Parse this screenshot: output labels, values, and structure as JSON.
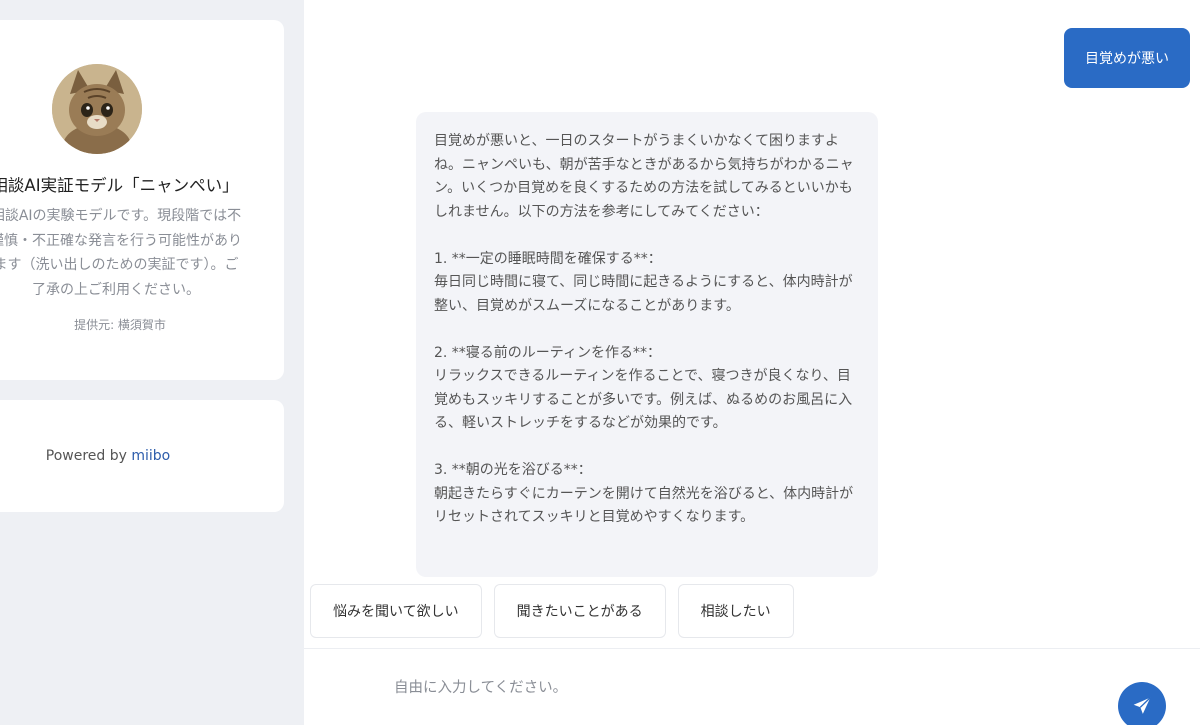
{
  "sidebar": {
    "bot_name": "相談AI実証モデル「ニャンぺい」",
    "description": "相談AIの実験モデルです。現段階では不謹慎・不正確な発言を行う可能性があります（洗い出しのための実証です）。ご了承の上ご利用ください。",
    "provider": "提供元: 横須賀市",
    "powered_prefix": "Powered by",
    "powered_brand": "miibo"
  },
  "chat": {
    "user_message": "目覚めが悪い",
    "bot_message": "目覚めが悪いと、一日のスタートがうまくいかなくて困りますよね。ニャンペいも、朝が苦手なときがあるから気持ちがわかるニャン。いくつか目覚めを良くするための方法を試してみるといいかもしれません。以下の方法を参考にしてみてください：\n\n1. **一定の睡眠時間を確保する**：\n毎日同じ時間に寝て、同じ時間に起きるようにすると、体内時計が整い、目覚めがスムーズになることがあります。\n\n2. **寝る前のルーティンを作る**：\nリラックスできるルーティンを作ることで、寝つきが良くなり、目覚めもスッキリすることが多いです。例えば、ぬるめのお風呂に入る、軽いストレッチをするなどが効果的です。\n\n3. **朝の光を浴びる**：\n朝起きたらすぐにカーテンを開けて自然光を浴びると、体内時計がリセットされてスッキリと目覚めやすくなります。"
  },
  "suggestions": [
    {
      "label": "悩みを聞いて欲しい"
    },
    {
      "label": "聞きたいことがある"
    },
    {
      "label": "相談したい"
    }
  ],
  "input": {
    "placeholder": "自由に入力してください。",
    "value": ""
  },
  "colors": {
    "accent": "#2a6bc5",
    "brand": "#2c5cab"
  },
  "icons": {
    "avatar": "cat-photo",
    "send": "paper-plane-icon"
  }
}
